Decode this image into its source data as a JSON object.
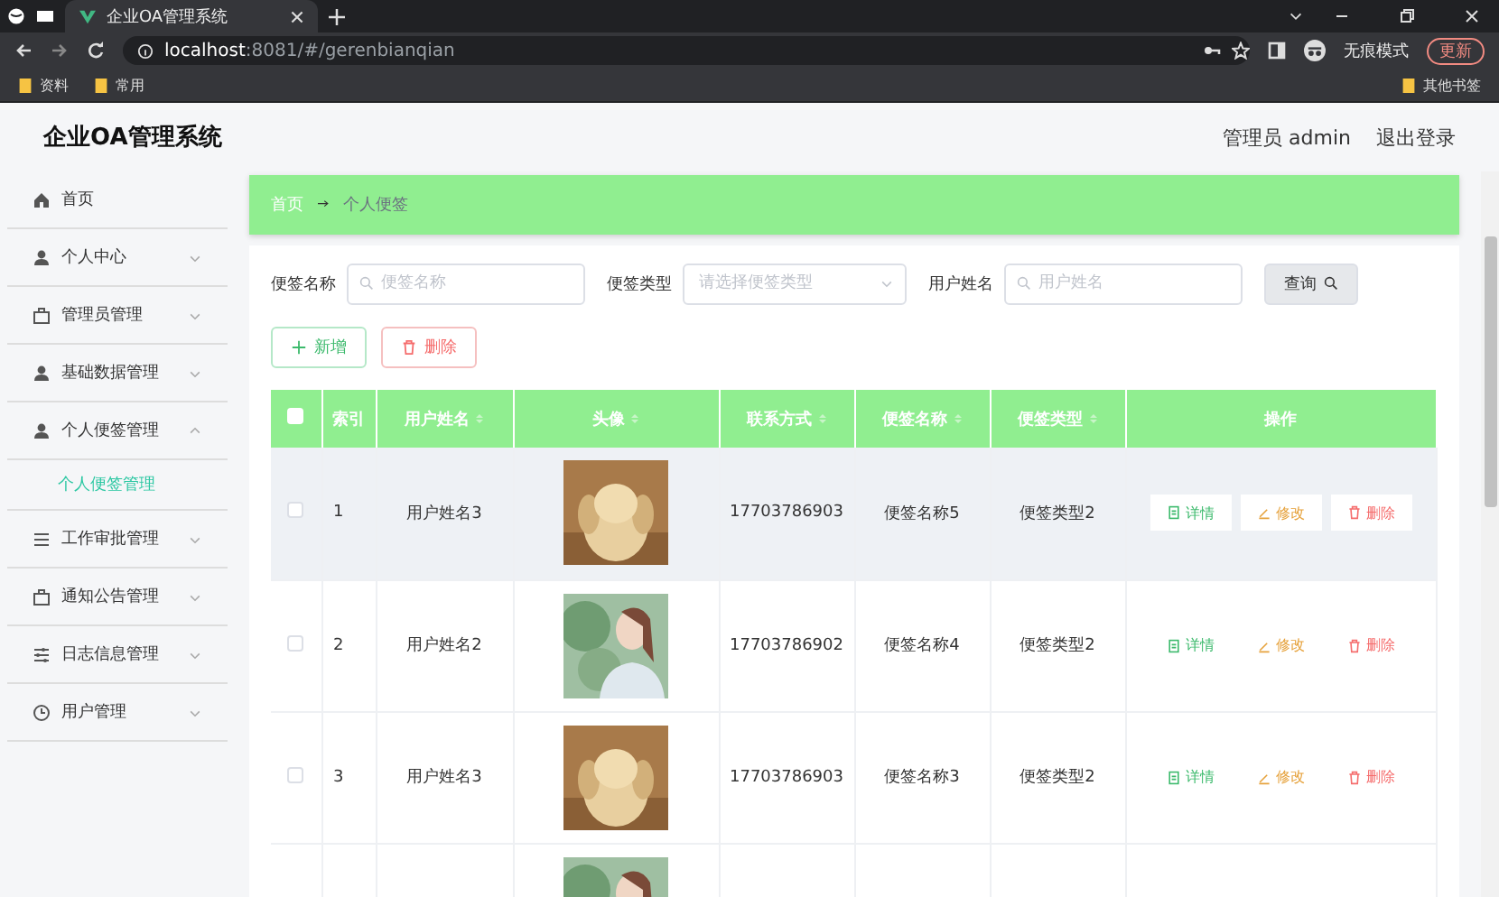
{
  "browser": {
    "tab_title": "企业OA管理系统",
    "url_host": "localhost",
    "url_rest": ":8081/#/gerenbianqian",
    "incognito": "无痕模式",
    "update": "更新",
    "bookmarks": [
      "资料",
      "常用"
    ],
    "other_bookmarks": "其他书签"
  },
  "header": {
    "title": "企业OA管理系统",
    "user": "管理员 admin",
    "logout": "退出登录"
  },
  "sidebar": {
    "items": [
      {
        "label": "首页"
      },
      {
        "label": "个人中心",
        "expanded": false
      },
      {
        "label": "管理员管理",
        "expanded": false
      },
      {
        "label": "基础数据管理",
        "expanded": false
      },
      {
        "label": "个人便签管理",
        "expanded": true,
        "children": [
          {
            "label": "个人便签管理",
            "selected": true
          }
        ]
      },
      {
        "label": "工作审批管理",
        "expanded": false
      },
      {
        "label": "通知公告管理",
        "expanded": false
      },
      {
        "label": "日志信息管理",
        "expanded": false
      },
      {
        "label": "用户管理",
        "expanded": false
      }
    ]
  },
  "breadcrumb": [
    "首页",
    "个人便签"
  ],
  "search": {
    "fields": [
      {
        "label": "便签名称",
        "kind": "input",
        "placeholder": "便签名称"
      },
      {
        "label": "便签类型",
        "kind": "select",
        "placeholder": "请选择便签类型"
      },
      {
        "label": "用户姓名",
        "kind": "input",
        "placeholder": "用户姓名"
      }
    ],
    "button": "查询"
  },
  "actions": [
    {
      "label": "新增",
      "kind": "add"
    },
    {
      "label": "删除",
      "kind": "delete"
    }
  ],
  "table": {
    "all_checked": false,
    "columns": [
      {
        "label": "索引",
        "sortable": false
      },
      {
        "label": "用户姓名",
        "sortable": true
      },
      {
        "label": "头像",
        "sortable": true
      },
      {
        "label": "联系方式",
        "sortable": true
      },
      {
        "label": "便签名称",
        "sortable": true
      },
      {
        "label": "便签类型",
        "sortable": true
      },
      {
        "label": "操作",
        "sortable": false
      }
    ],
    "rows": [
      {
        "index": "1",
        "name": "用户姓名3",
        "avatar": {
          "kind": "picture"
        },
        "phone": "17703786903",
        "note_name": "便签名称5",
        "note_type": "便签类型2",
        "checked": false,
        "highlighted": true,
        "buttons": [
          {
            "label": "详情",
            "kind": "detail"
          },
          {
            "label": "修改",
            "kind": "edit"
          },
          {
            "label": "删除",
            "kind": "delete"
          }
        ]
      },
      {
        "index": "2",
        "name": "用户姓名2",
        "avatar": {
          "kind": "picture"
        },
        "phone": "17703786902",
        "note_name": "便签名称4",
        "note_type": "便签类型2",
        "checked": false,
        "highlighted": false,
        "buttons": [
          {
            "label": "详情",
            "kind": "detail"
          },
          {
            "label": "修改",
            "kind": "edit"
          },
          {
            "label": "删除",
            "kind": "delete"
          }
        ]
      },
      {
        "index": "3",
        "name": "用户姓名3",
        "avatar": {
          "kind": "picture"
        },
        "phone": "17703786903",
        "note_name": "便签名称3",
        "note_type": "便签类型2",
        "checked": false,
        "highlighted": false,
        "buttons": [
          {
            "label": "详情",
            "kind": "detail"
          },
          {
            "label": "修改",
            "kind": "edit"
          },
          {
            "label": "删除",
            "kind": "delete"
          }
        ]
      },
      {
        "avatar": {
          "kind": "picture"
        },
        "highlighted": false,
        "buttons": []
      }
    ]
  }
}
